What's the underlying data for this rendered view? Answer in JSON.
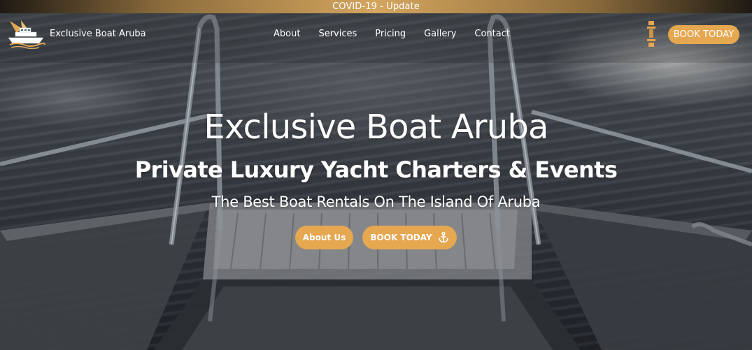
{
  "banner": {
    "text": "COVID-19 - Update"
  },
  "header": {
    "brand_name": "Exclusive Boat Aruba",
    "logo_icon": "yacht-logo-icon",
    "nav": [
      {
        "label": "About"
      },
      {
        "label": "Services"
      },
      {
        "label": "Pricing"
      },
      {
        "label": "Gallery"
      },
      {
        "label": "Contact"
      }
    ],
    "phone_icon": "phone-icon",
    "book_label": "BOOK TODAY"
  },
  "hero": {
    "title": "Exclusive Boat Aruba",
    "subtitle": "Private Luxury Yacht Charters & Events",
    "tagline": "The Best Boat Rentals On The Island Of Aruba",
    "about_button": "About Us",
    "book_button": "BOOK TODAY",
    "book_icon": "anchor-icon"
  },
  "colors": {
    "accent": "#e6a751",
    "banner_gold": "#d4a55e",
    "text": "#ffffff"
  }
}
